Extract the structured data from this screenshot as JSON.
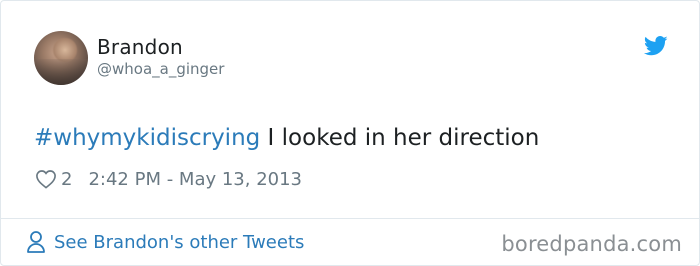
{
  "user": {
    "name": "Brandon",
    "handle": "@whoa_a_ginger"
  },
  "tweet": {
    "hashtag": "#whymykidiscrying",
    "text": " I looked in her direction",
    "likes": "2",
    "timestamp": "2:42 PM - May 13, 2013"
  },
  "footer": {
    "link_label": "See Brandon's other Tweets",
    "watermark": "boredpanda.com"
  },
  "colors": {
    "link": "#2b7bb9",
    "text": "#1c2022",
    "muted": "#697882",
    "twitter_blue": "#1da1f2"
  },
  "icons": [
    "twitter-bird-icon",
    "heart-icon",
    "person-icon"
  ]
}
